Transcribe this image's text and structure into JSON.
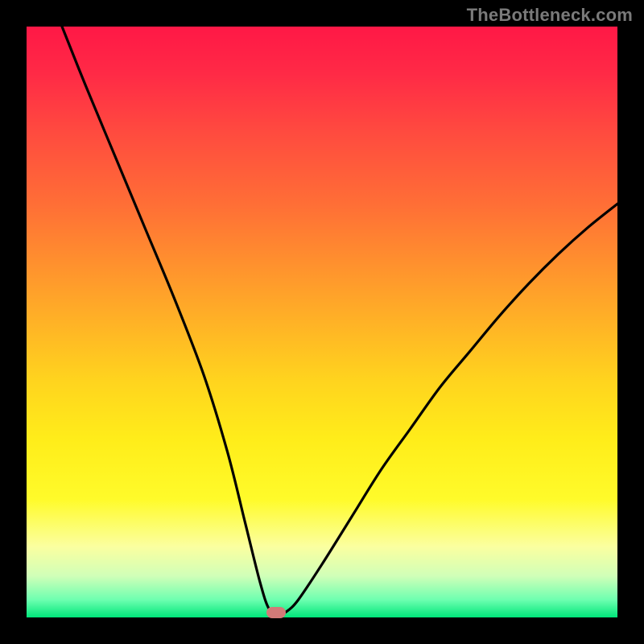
{
  "watermark": "TheBottleneck.com",
  "chart_data": {
    "type": "line",
    "title": "",
    "xlabel": "",
    "ylabel": "",
    "xlim": [
      0,
      100
    ],
    "ylim": [
      0,
      100
    ],
    "series": [
      {
        "name": "bottleneck-curve",
        "x": [
          6,
          10,
          15,
          20,
          25,
          30,
          34,
          37,
          39.5,
          41,
          42.5,
          44,
          46,
          50,
          55,
          60,
          65,
          70,
          75,
          80,
          85,
          90,
          95,
          100
        ],
        "y": [
          100,
          90,
          78,
          66,
          54,
          41,
          28,
          16,
          6,
          1.5,
          0.5,
          1,
          3,
          9,
          17,
          25,
          32,
          39,
          45,
          51,
          56.5,
          61.5,
          66,
          70
        ]
      }
    ],
    "marker": {
      "x": 42.2,
      "y": 0.8,
      "color": "#d27a78"
    },
    "background": "red-yellow-green vertical gradient",
    "grid": false,
    "legend": false
  }
}
